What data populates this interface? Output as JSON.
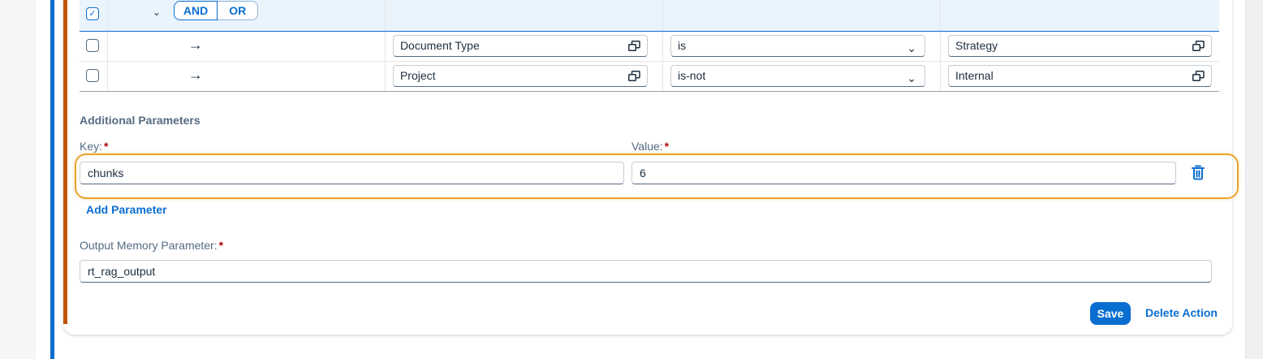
{
  "filter": {
    "and_label": "AND",
    "or_label": "OR",
    "rows": [
      {
        "field": "Document Type",
        "condition": "is",
        "value": "Strategy"
      },
      {
        "field": "Project",
        "condition": "is-not",
        "value": "Internal"
      }
    ]
  },
  "additional_parameters": {
    "title": "Additional Parameters",
    "key_label": "Key:",
    "value_label": "Value:",
    "required_mark": "*",
    "key_value": "chunks",
    "value_value": "6",
    "add_parameter_label": "Add Parameter"
  },
  "output": {
    "label": "Output Memory Parameter:",
    "required_mark": "*",
    "value": "rt_rag_output"
  },
  "actions": {
    "save_label": "Save",
    "delete_label": "Delete Action"
  },
  "icons": {
    "checkmark": "✓",
    "chevron_down": "⌄",
    "arrow_right": "→",
    "dropdown_arrow": "⌄"
  },
  "colors": {
    "accent": "#0a6ed1",
    "highlight": "#e9a42a",
    "rail_orange": "#c35500",
    "required": "#aa0808"
  }
}
